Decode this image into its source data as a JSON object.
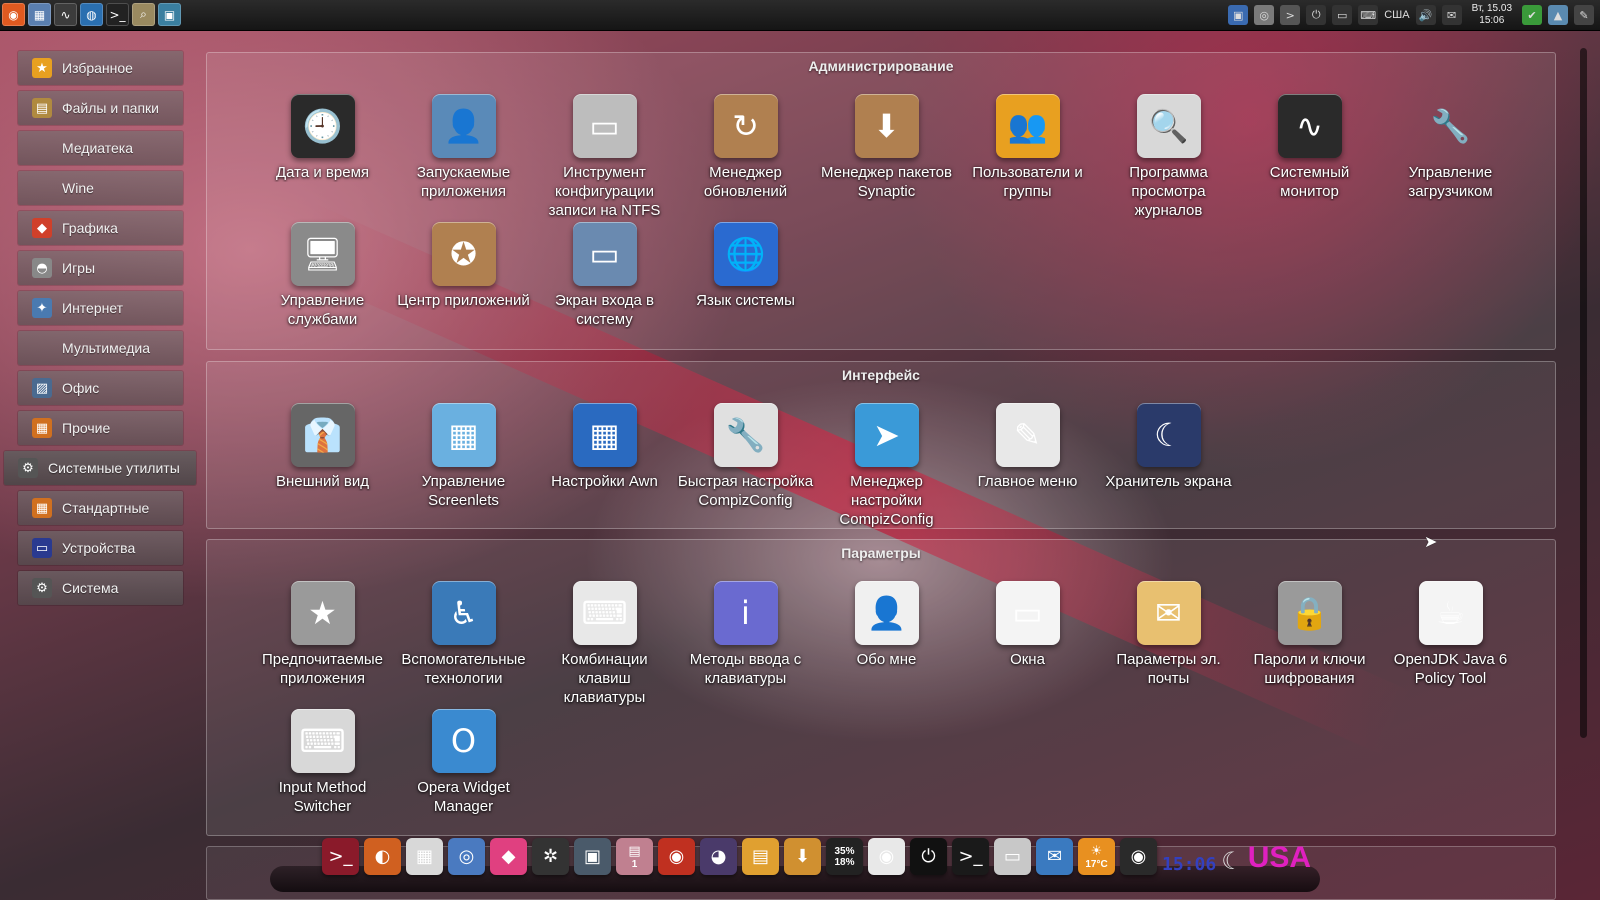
{
  "top_panel": {
    "left_icons": [
      {
        "name": "ubuntu-logo-icon",
        "glyph": "◉",
        "color": "#e05a20"
      },
      {
        "name": "desktop-icon",
        "glyph": "▦",
        "color": "#5a7fb0"
      },
      {
        "name": "system-monitor-icon",
        "glyph": "∿",
        "color": "#3c3c3c"
      },
      {
        "name": "browser-icon",
        "glyph": "◍",
        "color": "#2a6fb0"
      },
      {
        "name": "terminal-icon",
        "glyph": ">_",
        "color": "#222222"
      },
      {
        "name": "file-search-icon",
        "glyph": "⌕",
        "color": "#9a8a60"
      },
      {
        "name": "app-icon",
        "glyph": "▣",
        "color": "#3a7fa0"
      }
    ],
    "right_icons": [
      {
        "name": "display-icon",
        "glyph": "▣",
        "color": "#3a6ab0"
      },
      {
        "name": "camera-icon",
        "glyph": "◎",
        "color": "#7a7a7a"
      },
      {
        "name": "terminal-small-icon",
        "glyph": ">",
        "color": "#555555"
      },
      {
        "name": "power-icon",
        "glyph": "⏻",
        "color": "#333333"
      },
      {
        "name": "network-icon",
        "glyph": "▭",
        "color": "#333333"
      },
      {
        "name": "keyboard-icon",
        "glyph": "⌨",
        "color": "#333333"
      }
    ],
    "keyboard_layout": "США",
    "right_icons_2": [
      {
        "name": "volume-icon",
        "glyph": "🔊",
        "color": "#333333"
      },
      {
        "name": "mail-icon",
        "glyph": "✉",
        "color": "#333333"
      }
    ],
    "clock_date": "Вт, 15.03",
    "clock_time": "15:06",
    "right_icons_3": [
      {
        "name": "shield-icon",
        "glyph": "✔",
        "color": "#3a9a3a"
      },
      {
        "name": "photo-icon",
        "glyph": "▲",
        "color": "#5a8ab0"
      },
      {
        "name": "pen-icon",
        "glyph": "✎",
        "color": "#444444"
      }
    ]
  },
  "sidebar": {
    "categories": [
      {
        "label": "Избранное",
        "icon": "star-icon",
        "glyph": "★",
        "color": "#e8a020",
        "active": false
      },
      {
        "label": "Файлы и папки",
        "icon": "folder-icon",
        "glyph": "▤",
        "color": "#b08a40",
        "active": false
      },
      {
        "label": "Медиатека",
        "icon": "",
        "glyph": "",
        "color": "",
        "active": false
      },
      {
        "label": "Wine",
        "icon": "",
        "glyph": "",
        "color": "",
        "active": false
      },
      {
        "label": "Графика",
        "icon": "graphics-icon",
        "glyph": "◆",
        "color": "#d0402a",
        "active": false
      },
      {
        "label": "Игры",
        "icon": "gamepad-icon",
        "glyph": "◓",
        "color": "#888888",
        "active": false
      },
      {
        "label": "Интернет",
        "icon": "internet-icon",
        "glyph": "✦",
        "color": "#4a7ab0",
        "active": false
      },
      {
        "label": "Мультимедиа",
        "icon": "",
        "glyph": "",
        "color": "",
        "active": false
      },
      {
        "label": "Офис",
        "icon": "office-icon",
        "glyph": "▨",
        "color": "#4a6a90",
        "active": false
      },
      {
        "label": "Прочие",
        "icon": "other-icon",
        "glyph": "▦",
        "color": "#d07020",
        "active": false
      },
      {
        "label": "Системные утилиты",
        "icon": "system-tools-icon",
        "glyph": "⚙",
        "color": "#555555",
        "active": true
      },
      {
        "label": "Стандартные",
        "icon": "accessories-icon",
        "glyph": "▦",
        "color": "#d07020",
        "active": false
      },
      {
        "label": "Устройства",
        "icon": "devices-icon",
        "glyph": "▭",
        "color": "#2a3a90",
        "active": false
      },
      {
        "label": "Система",
        "icon": "system-icon",
        "glyph": "⚙",
        "color": "#555555",
        "active": false
      }
    ]
  },
  "sections": [
    {
      "title": "Администрирование",
      "apps": [
        {
          "label": "Дата и время",
          "icon": "calendar-clock-icon",
          "glyph": "🕘",
          "color": "#2a2a2a"
        },
        {
          "label": "Запускаемые приложения",
          "icon": "startup-apps-icon",
          "glyph": "👤",
          "color": "#5a8ab8"
        },
        {
          "label": "Инструмент конфигурации записи на NTFS",
          "icon": "ntfs-config-icon",
          "glyph": "▭",
          "color": "#bdbdbd"
        },
        {
          "label": "Менеджер обновлений",
          "icon": "update-manager-icon",
          "glyph": "↻",
          "color": "#b08050"
        },
        {
          "label": "Менеджер пакетов Synaptic",
          "icon": "synaptic-icon",
          "glyph": "⬇",
          "color": "#b08050"
        },
        {
          "label": "Пользователи и группы",
          "icon": "users-groups-icon",
          "glyph": "👥",
          "color": "#e8a020"
        },
        {
          "label": "Программа просмотра журналов",
          "icon": "log-viewer-icon",
          "glyph": "🔍",
          "color": "#d8d8d8"
        },
        {
          "label": "Системный монитор",
          "icon": "system-monitor-icon",
          "glyph": "∿",
          "color": "#2a2a2a"
        },
        {
          "label": "Управление загрузчиком",
          "icon": "bootloader-icon",
          "glyph": "🔧",
          "color": "transparent"
        },
        {
          "label": "Управление службами",
          "icon": "services-icon",
          "glyph": "🖥",
          "color": "#8a8a8a"
        },
        {
          "label": "Центр приложений",
          "icon": "software-center-icon",
          "glyph": "✪",
          "color": "#b08050"
        },
        {
          "label": "Экран входа в систему",
          "icon": "login-screen-icon",
          "glyph": "▭",
          "color": "#6a8ab0"
        },
        {
          "label": "Язык системы",
          "icon": "language-icon",
          "glyph": "🌐",
          "color": "#2a6ad0"
        }
      ]
    },
    {
      "title": "Интерфейс",
      "apps": [
        {
          "label": "Внешний вид",
          "icon": "appearance-icon",
          "glyph": "👔",
          "color": "#666666"
        },
        {
          "label": "Управление Screenlets",
          "icon": "screenlets-icon",
          "glyph": "▦",
          "color": "#6ab0e0"
        },
        {
          "label": "Настройки Awn",
          "icon": "awn-settings-icon",
          "glyph": "▦",
          "color": "#2a6ac0"
        },
        {
          "label": "Быстрая настройка CompizConfig",
          "icon": "compizconfig-simple-icon",
          "glyph": "🔧",
          "color": "#e0e0e0"
        },
        {
          "label": "Менеджер настройки CompizConfig",
          "icon": "compizconfig-manager-icon",
          "glyph": "➤",
          "color": "#3a9ad8"
        },
        {
          "label": "Главное меню",
          "icon": "main-menu-icon",
          "glyph": "✎",
          "color": "#e8e8e8"
        },
        {
          "label": "Хранитель экрана",
          "icon": "screensaver-icon",
          "glyph": "☾",
          "color": "#2a3a6a"
        }
      ]
    },
    {
      "title": "Параметры",
      "apps": [
        {
          "label": "Предпочитаемые приложения",
          "icon": "preferred-apps-icon",
          "glyph": "★",
          "color": "#9a9a9a"
        },
        {
          "label": "Вспомогательные технологии",
          "icon": "accessibility-icon",
          "glyph": "♿",
          "color": "#3a7ab8"
        },
        {
          "label": "Комбинации клавиш клавиатуры",
          "icon": "keyboard-shortcuts-icon",
          "glyph": "⌨",
          "color": "#e8e8e8"
        },
        {
          "label": "Методы ввода с клавиатуры",
          "icon": "input-methods-icon",
          "glyph": "i",
          "color": "#6a6ad0"
        },
        {
          "label": "Обо мне",
          "icon": "about-me-icon",
          "glyph": "👤",
          "color": "#f0f0f0"
        },
        {
          "label": "Окна",
          "icon": "windows-icon",
          "glyph": "▭",
          "color": "#f4f4f4"
        },
        {
          "label": "Параметры эл. почты",
          "icon": "email-settings-icon",
          "glyph": "✉",
          "color": "#e8c070"
        },
        {
          "label": "Пароли и ключи шифрования",
          "icon": "passwords-keys-icon",
          "glyph": "🔒",
          "color": "#9a9a9a"
        },
        {
          "label": "OpenJDK Java 6 Policy Tool",
          "icon": "java-icon",
          "glyph": "☕",
          "color": "#f4f4f4"
        },
        {
          "label": "Input Method Switcher",
          "icon": "input-method-switcher-icon",
          "glyph": "⌨",
          "color": "#d8d8d8"
        },
        {
          "label": "Opera Widget Manager",
          "icon": "opera-widget-icon",
          "glyph": "O",
          "color": "#3a8ad0"
        }
      ]
    }
  ],
  "dock": {
    "items": [
      {
        "name": "terminal-dock-icon",
        "glyph": ">_",
        "color": "#8a1a2a",
        "text": ""
      },
      {
        "name": "firefox-dock-icon",
        "glyph": "◐",
        "color": "#d06020",
        "text": ""
      },
      {
        "name": "calculator-dock-icon",
        "glyph": "▦",
        "color": "#d8d8d8",
        "text": ""
      },
      {
        "name": "people-dock-icon",
        "glyph": "◎",
        "color": "#4a7ac0",
        "text": ""
      },
      {
        "name": "color-dock-icon",
        "glyph": "◆",
        "color": "#e04080",
        "text": ""
      },
      {
        "name": "settings-dock-icon",
        "glyph": "✲",
        "color": "#333333",
        "text": ""
      },
      {
        "name": "window-dock-icon",
        "glyph": "▣",
        "color": "#4a5a6a",
        "text": ""
      },
      {
        "name": "workspace-dock-icon",
        "glyph": "▤",
        "color": "#c08090",
        "text": "1"
      },
      {
        "name": "ubuntu-dock-icon",
        "glyph": "◉",
        "color": "#c03020",
        "text": ""
      },
      {
        "name": "pidgin-dock-icon",
        "glyph": "◕",
        "color": "#4a3a6a",
        "text": ""
      },
      {
        "name": "notes-dock-icon",
        "glyph": "▤",
        "color": "#e0a030",
        "text": ""
      },
      {
        "name": "download-dock-icon",
        "glyph": "⬇",
        "color": "#d09030",
        "text": ""
      },
      {
        "name": "cpu-meter-dock-icon",
        "glyph": "",
        "color": "#222222",
        "text": "35%\n18%"
      },
      {
        "name": "cd-dock-icon",
        "glyph": "◉",
        "color": "#e8e8e8",
        "text": ""
      },
      {
        "name": "power-dock-icon",
        "glyph": "⏻",
        "color": "#111111",
        "text": ""
      },
      {
        "name": "terminal2-dock-icon",
        "glyph": ">_",
        "color": "#1a1a1a",
        "text": ""
      },
      {
        "name": "trash-dock-icon",
        "glyph": "▭",
        "color": "#c8c8c8",
        "text": ""
      },
      {
        "name": "mail-dock-icon",
        "glyph": "✉",
        "color": "#3a7ac0",
        "text": ""
      },
      {
        "name": "weather-dock-icon",
        "glyph": "☀",
        "color": "#e89020",
        "text": "17°C"
      },
      {
        "name": "speaker-dock-icon",
        "glyph": "◉",
        "color": "#2a2a2a",
        "text": ""
      }
    ],
    "clock": "15:06",
    "moon_glyph": "☾",
    "keyboard": "USA"
  }
}
